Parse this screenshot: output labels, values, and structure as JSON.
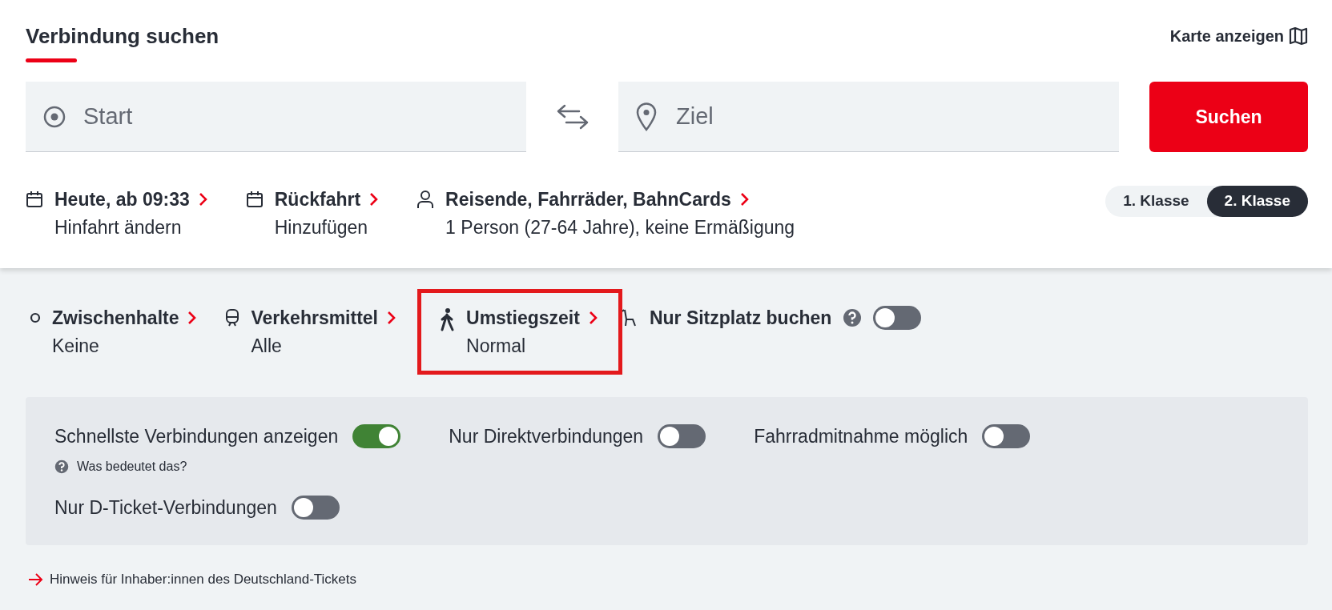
{
  "header": {
    "title": "Verbindung suchen",
    "map_link": "Karte anzeigen"
  },
  "search": {
    "start": {
      "placeholder": "Start"
    },
    "destination": {
      "placeholder": "Ziel"
    },
    "button": "Suchen"
  },
  "trip": [
    {
      "kind": "calendar",
      "label": "Heute, ab 09:33",
      "value": "Hinfahrt ändern"
    },
    {
      "kind": "calendar",
      "label": "Rückfahrt",
      "value": "Hinzufügen"
    },
    {
      "kind": "person",
      "label": "Reisende, Fahrräder, BahnCards",
      "value": "1 Person (27-64 Jahre), keine Ermäßigung"
    }
  ],
  "class_toggle": [
    {
      "label": "1. Klasse",
      "selected": false
    },
    {
      "label": "2. Klasse",
      "selected": true
    }
  ],
  "options": [
    {
      "kind": "stops",
      "label": "Zwischenhalte",
      "value": "Keine",
      "highlighted": false
    },
    {
      "kind": "train",
      "label": "Verkehrsmittel",
      "value": "Alle",
      "highlighted": false
    },
    {
      "kind": "walk",
      "label": "Umstiegszeit",
      "value": "Normal",
      "highlighted": true
    }
  ],
  "seat_only": {
    "label": "Nur Sitzplatz buchen",
    "on": false
  },
  "filters": [
    {
      "label": "Schnellste Verbindungen anzeigen",
      "on": true,
      "help": "Was bedeutet das?"
    },
    {
      "label": "Nur Direktverbindungen",
      "on": false
    },
    {
      "label": "Fahrradmitnahme möglich",
      "on": false
    },
    {
      "label": "Nur D-Ticket-Verbindungen",
      "on": false
    }
  ],
  "hint_link": "Hinweis für Inhaber:innen des Deutschland-Tickets"
}
